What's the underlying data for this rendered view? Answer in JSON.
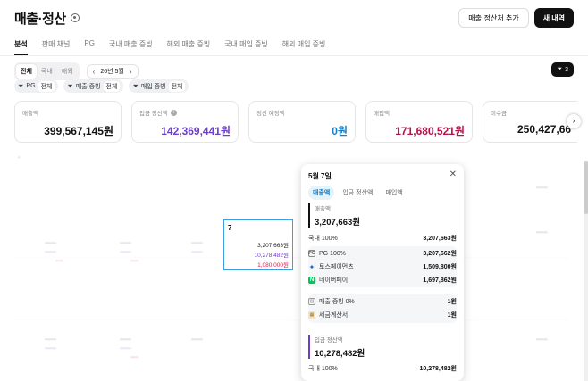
{
  "header": {
    "title": "매출·정산",
    "add_settlement_label": "매출·정산처 추가",
    "new_entry_label": "새 내역"
  },
  "tabs": [
    "분석",
    "판매 채널",
    "PG",
    "국내 매출 증빙",
    "해외 매출 증빙",
    "국내 매입 증빙",
    "해외 매입 증빙"
  ],
  "active_tab": "분석",
  "region_filter": {
    "options": [
      "전체",
      "국내",
      "해외"
    ],
    "selected": "전체"
  },
  "date_nav": {
    "label": "26년 5월",
    "prev": "‹",
    "next": "›"
  },
  "filter_count": "3",
  "chips": [
    {
      "label": "PG",
      "value": "전체"
    },
    {
      "label": "매출 증빙",
      "value": "전체"
    },
    {
      "label": "매입 증빙",
      "value": "전체"
    }
  ],
  "cards": [
    {
      "label": "매출액",
      "amount": "399,567,145원",
      "color": "#111111"
    },
    {
      "label": "입금 정산액",
      "amount": "142,369,441원",
      "color": "#6c3fc7"
    },
    {
      "label": "정산 예정액",
      "amount": "0원",
      "color": "#1a7ec4"
    },
    {
      "label": "매입액",
      "amount": "171,680,521원",
      "color": "#b5124a"
    },
    {
      "label": "미수금",
      "amount": "250,427,66",
      "color": "#111111"
    }
  ],
  "selected_day": {
    "day": "7",
    "sales": "3,207,663원",
    "deposit": "10,278,482원",
    "purchase": "1,080,000원"
  },
  "popover": {
    "title": "5월 7일",
    "tabs": [
      "매출액",
      "입금 정산액",
      "매입액"
    ],
    "active_tab": "매출액",
    "sales": {
      "label": "매출액",
      "amount": "3,207,663원",
      "domestic_label": "국내 100%",
      "domestic_value": "3,207,663원",
      "pg_label": "PG 100%",
      "pg_value": "3,207,662원",
      "toss_label": "토스페이먼츠",
      "toss_value": "1,509,800원",
      "naver_label": "네이버페이",
      "naver_value": "1,697,862원",
      "evidence_label": "매출 증빙 0%",
      "evidence_value": "1원",
      "tax_label": "세금계산서",
      "tax_value": "1원"
    },
    "deposit": {
      "label": "입금 정산액",
      "amount": "10,278,482원",
      "domestic_label": "국내 100%",
      "domestic_value": "10,278,482원"
    }
  }
}
